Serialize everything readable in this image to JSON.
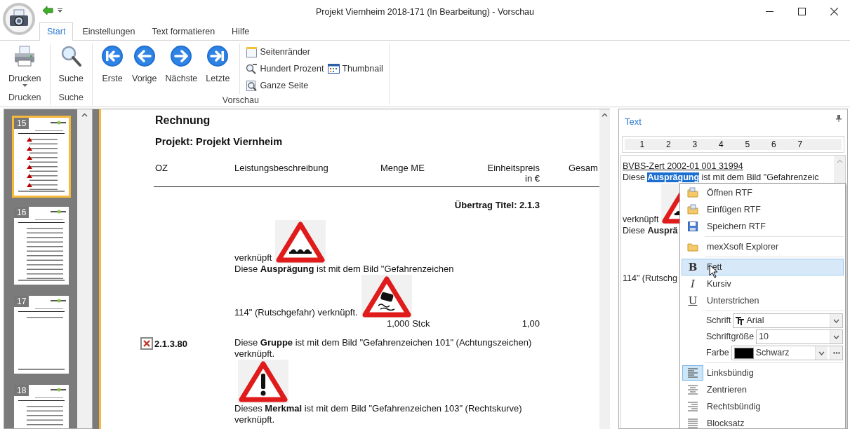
{
  "window": {
    "title": "Projekt Viernheim 2018-171 (In Bearbeitung) - Vorschau"
  },
  "tabs": [
    {
      "label": "Start",
      "selected": true
    },
    {
      "label": "Einstellungen",
      "selected": false
    },
    {
      "label": "Text formatieren",
      "selected": false
    },
    {
      "label": "Hilfe",
      "selected": false
    }
  ],
  "ribbon": [
    {
      "label": "Drucken",
      "buttons": [
        {
          "kind": "large",
          "label": "Drucken",
          "dropdown": true
        }
      ]
    },
    {
      "label": "Suche",
      "buttons": [
        {
          "kind": "large",
          "label": "Suche"
        }
      ]
    },
    {
      "label": "Vorschau",
      "buttons": [
        {
          "kind": "large",
          "label": "Erste"
        },
        {
          "kind": "large",
          "label": "Vorige"
        },
        {
          "kind": "large",
          "label": "Nächste"
        },
        {
          "kind": "large",
          "label": "Letzte"
        },
        {
          "kind": "small",
          "label": "Seitenränder"
        },
        {
          "kind": "small",
          "label": "Hundert Prozent"
        },
        {
          "kind": "small",
          "label": "Thumbnail"
        },
        {
          "kind": "small",
          "label": "Ganze Seite"
        }
      ]
    }
  ],
  "thumbnails": [
    {
      "number": "15",
      "selected": true
    },
    {
      "number": "16",
      "selected": false
    },
    {
      "number": "17",
      "selected": false
    },
    {
      "number": "18",
      "selected": false
    }
  ],
  "document": {
    "title": "Rechnung",
    "subtitle": "Projekt: Projekt Viernheim",
    "columns": [
      {
        "lines": [
          "OZ"
        ]
      },
      {
        "lines": [
          "Leistungsbeschreibung"
        ]
      },
      {
        "lines": [
          "Menge ME"
        ]
      },
      {
        "lines": [
          "Einheitspreis",
          "in €"
        ]
      },
      {
        "lines": [
          "Gesam"
        ]
      }
    ],
    "carry_over": "Übertrag Titel: 2.1.3",
    "positions": [
      {
        "lines": [
          {
            "text": "verknüpft",
            "image": true
          },
          {
            "text": "Diese **Ausprägung** ist mit dem Bild \"Gefahrenzeichen"
          },
          {
            "text": "114\" (Rutschgefahr) verknüpft.",
            "image": true
          }
        ],
        "quantity": "1,000 Stck",
        "unit_price": "1,00"
      },
      {
        "oz": "2.1.3.80",
        "error": true,
        "lines": [
          {
            "text": "Diese **Gruppe** ist mit dem Bild \"Gefahrenzeichen 101\" (Achtungszeichen)"
          },
          {
            "text": "verknüpft."
          },
          {
            "image": true
          },
          {
            "text": "Dieses **Merkmal** ist mit dem Bild \"Gefahrenzeichen 103\" (Rechtskurve)"
          },
          {
            "text": "verknüpft."
          }
        ]
      }
    ]
  },
  "text_panel": {
    "title": "Text",
    "ruler": [
      "1",
      "2",
      "3",
      "4",
      "5",
      "6",
      "7"
    ],
    "lines": [
      {
        "kind": "plain",
        "text": "BVBS-Zert 2002-01 001 31994",
        "underlined": true
      },
      {
        "kind": "selection",
        "before": "Diese ",
        "selected_text": "Ausprägung",
        "after": " ist mit dem Bild \"Gefahrenzeic"
      },
      {
        "kind": "plain",
        "text": "verknüpft",
        "image": true
      },
      {
        "kind": "plain",
        "text": "Diese **Ausprä**"
      },
      {
        "kind": "plain",
        "text": "114\" (Rutschg"
      }
    ]
  },
  "context_menu": [
    {
      "kind": "item",
      "label": "Öffnen RTF",
      "selected": false,
      "checked": false
    },
    {
      "kind": "item",
      "label": "Einfügen RTF",
      "selected": false,
      "checked": false
    },
    {
      "kind": "item",
      "label": "Speichern RTF",
      "selected": false,
      "checked": false
    },
    {
      "kind": "separator"
    },
    {
      "kind": "item",
      "label": "mexXsoft Explorer",
      "selected": false,
      "checked": false
    },
    {
      "kind": "separator"
    },
    {
      "kind": "item",
      "label": "Fett",
      "glyph": "B",
      "selected": true,
      "checked": false
    },
    {
      "kind": "item",
      "label": "Kursiv",
      "glyph": "I",
      "selected": false,
      "checked": false
    },
    {
      "kind": "item",
      "label": "Unterstrichen",
      "glyph": "U",
      "selected": false,
      "checked": false
    },
    {
      "kind": "separator"
    },
    {
      "kind": "combo",
      "label": "Schrift",
      "value": "Arial"
    },
    {
      "kind": "combo",
      "label": "Schriftgröße",
      "value": "10"
    },
    {
      "kind": "color",
      "label": "Farbe",
      "value": "Schwarz",
      "color": "#000000"
    },
    {
      "kind": "separator"
    },
    {
      "kind": "item",
      "label": "Linksbündig",
      "selected": false,
      "checked": true
    },
    {
      "kind": "item",
      "label": "Zentrieren",
      "selected": false,
      "checked": false
    },
    {
      "kind": "item",
      "label": "Rechtsbündig",
      "selected": false,
      "checked": false
    },
    {
      "kind": "item",
      "label": "Blocksatz",
      "selected": false,
      "checked": false
    }
  ]
}
